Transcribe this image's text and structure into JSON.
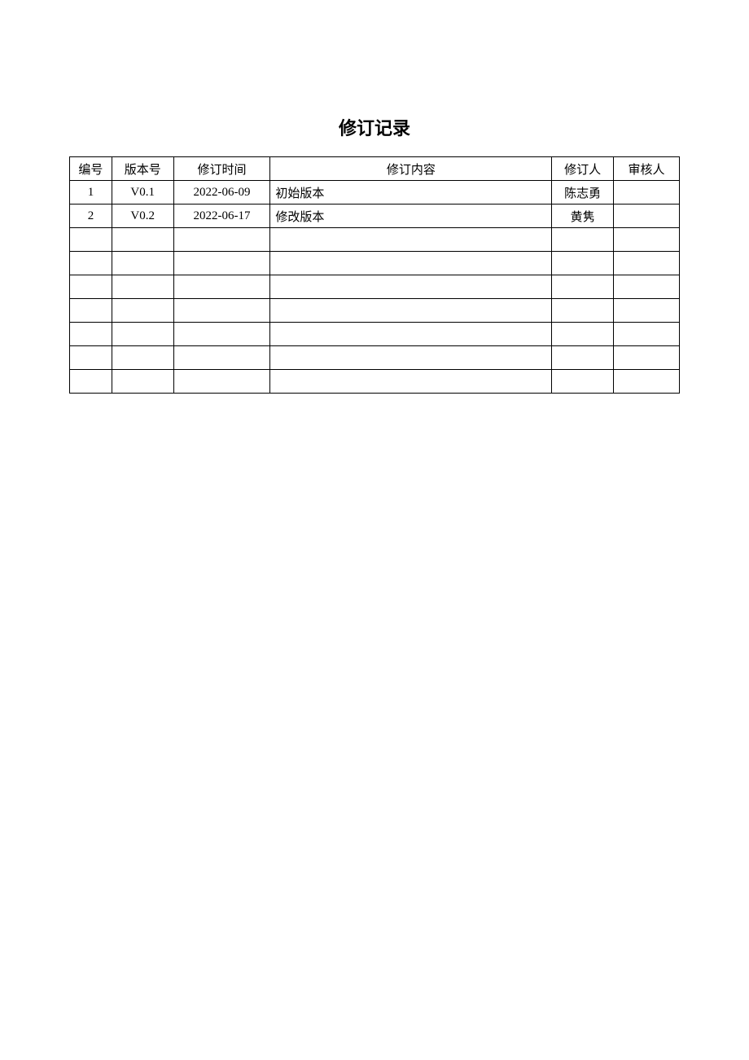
{
  "title": "修订记录",
  "headers": {
    "id": "编号",
    "version": "版本号",
    "date": "修订时间",
    "content": "修订内容",
    "editor": "修订人",
    "reviewer": "审核人"
  },
  "rows": [
    {
      "id": "1",
      "version": "V0.1",
      "date": "2022-06-09",
      "content": "初始版本",
      "editor": "陈志勇",
      "reviewer": ""
    },
    {
      "id": "2",
      "version": "V0.2",
      "date": "2022-06-17",
      "content": "修改版本",
      "editor": "黄隽",
      "reviewer": ""
    },
    {
      "id": "",
      "version": "",
      "date": "",
      "content": "",
      "editor": "",
      "reviewer": ""
    },
    {
      "id": "",
      "version": "",
      "date": "",
      "content": "",
      "editor": "",
      "reviewer": ""
    },
    {
      "id": "",
      "version": "",
      "date": "",
      "content": "",
      "editor": "",
      "reviewer": ""
    },
    {
      "id": "",
      "version": "",
      "date": "",
      "content": "",
      "editor": "",
      "reviewer": ""
    },
    {
      "id": "",
      "version": "",
      "date": "",
      "content": "",
      "editor": "",
      "reviewer": ""
    },
    {
      "id": "",
      "version": "",
      "date": "",
      "content": "",
      "editor": "",
      "reviewer": ""
    },
    {
      "id": "",
      "version": "",
      "date": "",
      "content": "",
      "editor": "",
      "reviewer": ""
    }
  ]
}
